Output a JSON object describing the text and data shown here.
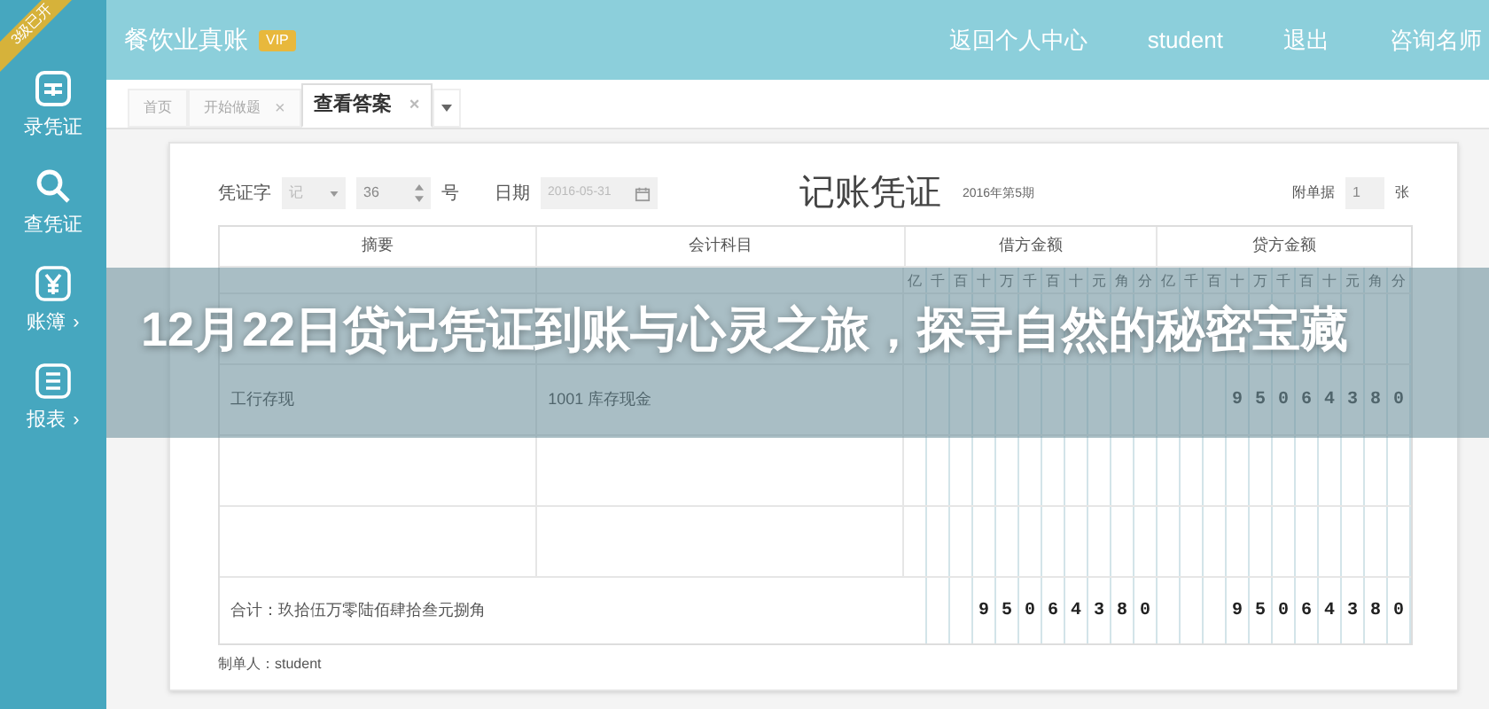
{
  "sidebar": {
    "ribbon": "3级已开",
    "items": [
      {
        "label": "录凭证"
      },
      {
        "label": "查凭证"
      },
      {
        "label": "账簿",
        "expander": "›"
      },
      {
        "label": "报表",
        "expander": "›"
      }
    ]
  },
  "header": {
    "title": "餐饮业真账",
    "badge": "VIP",
    "links": [
      "返回个人中心",
      "student",
      "退出",
      "咨询名师"
    ]
  },
  "tabs": [
    {
      "label": "首页",
      "selected": false
    },
    {
      "label": "开始做题",
      "close": "×",
      "selected": false
    },
    {
      "label": "查看答案",
      "close": "×",
      "selected": true
    }
  ],
  "voucher": {
    "prefix_label": "凭证字",
    "prefix_value": "记",
    "number": "36",
    "number_suffix": "号",
    "date_label": "日期",
    "date": "2016-05-31",
    "title": "记账凭证",
    "period": "2016年第5期",
    "attachments_label": "附单据",
    "attachments": "1",
    "attachments_suffix": "张"
  },
  "table": {
    "columns": [
      "摘要",
      "会计科目",
      "借方金额",
      "贷方金额"
    ],
    "debit_units": [
      "亿",
      "千",
      "百",
      "十",
      "万",
      "千",
      "百",
      "十",
      "元",
      "角",
      "分"
    ],
    "credit_units": [
      "亿",
      "千",
      "百",
      "十",
      "万",
      "千",
      "百",
      "十",
      "元",
      "角",
      "分"
    ],
    "rows": [
      {
        "kind": "blank"
      },
      {
        "kind": "entry",
        "summary": "工行存现",
        "account": "1001 库存现金",
        "credit": "95064380"
      },
      {
        "kind": "blank"
      },
      {
        "kind": "blank"
      }
    ],
    "total": {
      "label": "合计：玖拾伍万零陆佰肆拾叁元捌角",
      "debit": "95064380",
      "credit": "95064380"
    }
  },
  "preparer": "制单人：student",
  "banner": {
    "title": "12月22日贷记凭证到账与心灵之旅，探寻自然的秘密宝藏"
  }
}
